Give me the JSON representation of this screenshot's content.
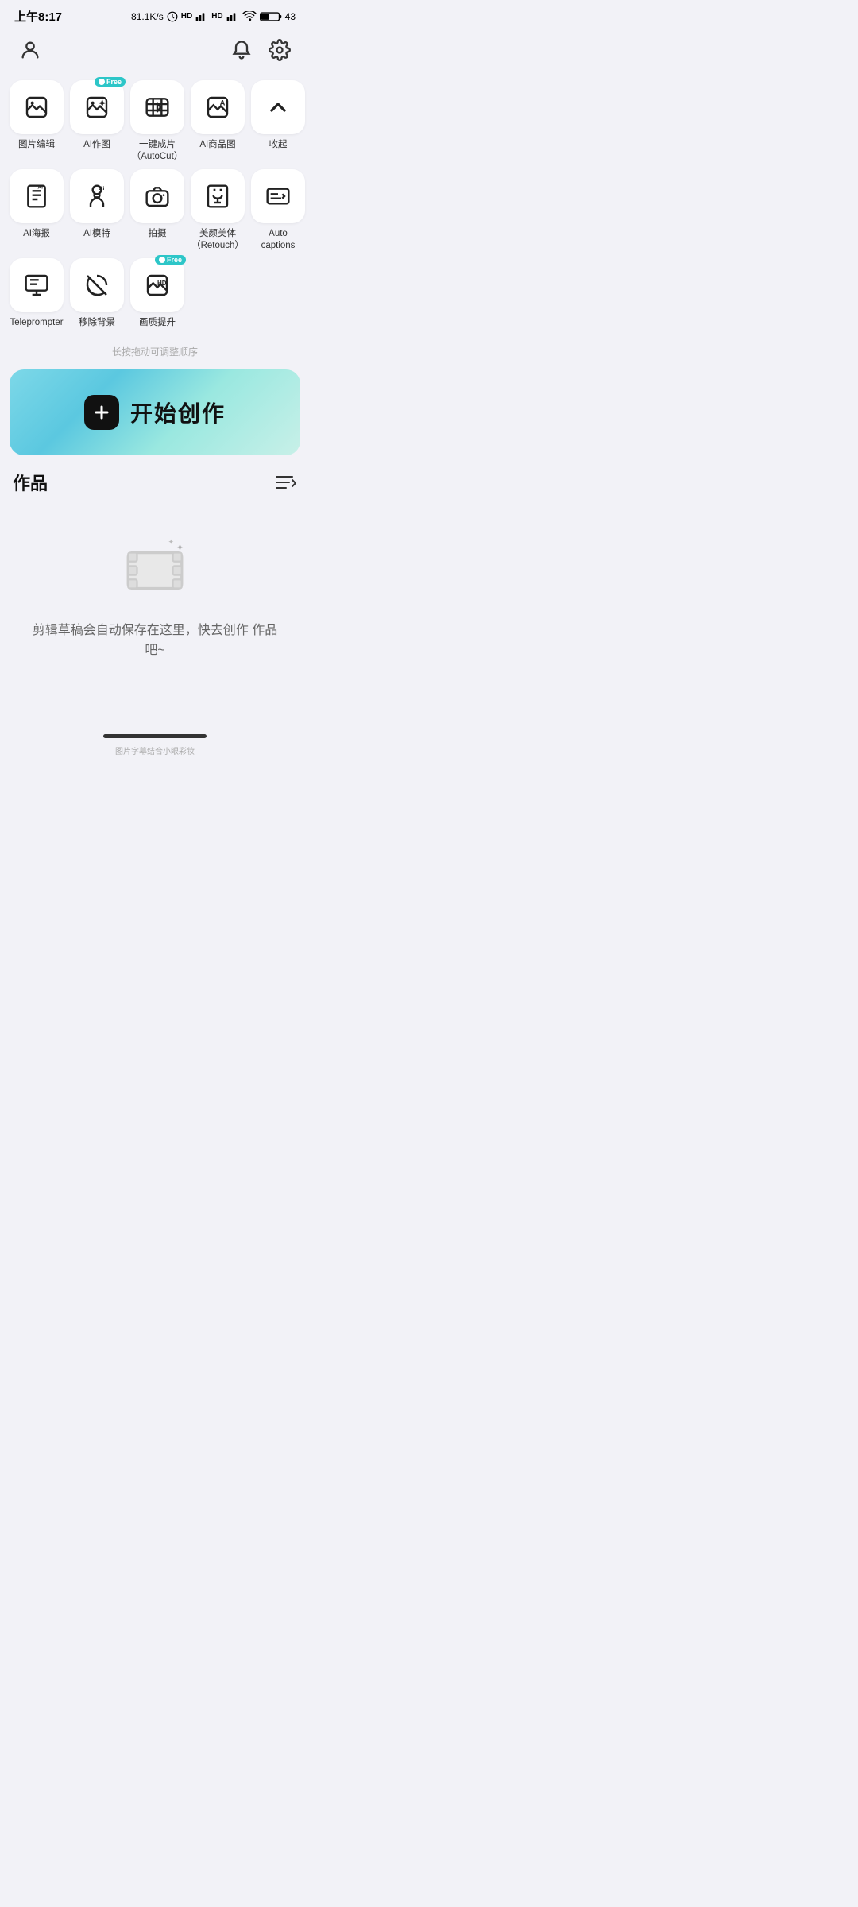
{
  "statusBar": {
    "time": "上午8:17",
    "speed": "81.1K/s",
    "battery": "43"
  },
  "nav": {
    "userIcon": "user-icon",
    "bellIcon": "bell-icon",
    "settingsIcon": "settings-icon"
  },
  "toolRows": [
    {
      "id": "row1",
      "items": [
        {
          "id": "pic-edit",
          "label": "图片编辑",
          "icon": "pic-edit-icon",
          "badge": null
        },
        {
          "id": "ai-draw",
          "label": "AI作图",
          "icon": "ai-draw-icon",
          "badge": "Free"
        },
        {
          "id": "autocut",
          "label": "一键成片\n（AutoCut）",
          "icon": "autocut-icon",
          "badge": null
        },
        {
          "id": "ai-product",
          "label": "AI商品图",
          "icon": "ai-product-icon",
          "badge": null
        },
        {
          "id": "collapse",
          "label": "收起",
          "icon": "chevron-up-icon",
          "badge": null
        }
      ]
    },
    {
      "id": "row2",
      "items": [
        {
          "id": "ai-poster",
          "label": "AI海报",
          "icon": "ai-poster-icon",
          "badge": null
        },
        {
          "id": "ai-model",
          "label": "AI模特",
          "icon": "ai-model-icon",
          "badge": null
        },
        {
          "id": "camera",
          "label": "拍摄",
          "icon": "camera-icon",
          "badge": null
        },
        {
          "id": "retouch",
          "label": "美颜美体\n（Retouch）",
          "icon": "retouch-icon",
          "badge": null
        },
        {
          "id": "autocaptions",
          "label": "Auto captions",
          "icon": "autocaptions-icon",
          "badge": null
        }
      ]
    },
    {
      "id": "row3",
      "items": [
        {
          "id": "teleprompter",
          "label": "Teleprompter",
          "icon": "teleprompter-icon",
          "badge": null
        },
        {
          "id": "remove-bg",
          "label": "移除背景",
          "icon": "remove-bg-icon",
          "badge": null
        },
        {
          "id": "enhance",
          "label": "画质提升",
          "icon": "enhance-icon",
          "badge": "Free"
        }
      ]
    }
  ],
  "dragHint": "长按拖动可调整顺序",
  "createBanner": {
    "plusLabel": "+",
    "label": "开始创作"
  },
  "works": {
    "title": "作品",
    "emptyText": "剪辑草稿会自动保存在这里，快去创作\n作品吧~"
  },
  "watermark": "图片字幕结合小眼彩妆"
}
